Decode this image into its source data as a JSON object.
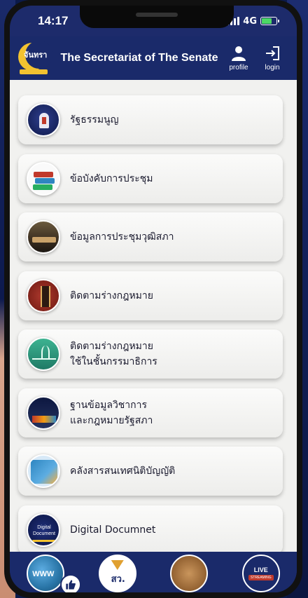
{
  "status_bar": {
    "time": "14:17",
    "network": "4G"
  },
  "header": {
    "logo_text": "จันทรา",
    "title": "The Secretariat of The Senate",
    "profile_label": "profile",
    "login_label": "login"
  },
  "menu": {
    "items": [
      {
        "icon": "constitution-icon",
        "label_line1": "รัฐธรรมนูญ",
        "label_line2": ""
      },
      {
        "icon": "books-icon",
        "label_line1": "ข้อบังคับการประชุม",
        "label_line2": ""
      },
      {
        "icon": "meeting-chamber-icon",
        "label_line1": "ข้อมูลการประชุมวุฒิสภา",
        "label_line2": ""
      },
      {
        "icon": "law-tracking-icon",
        "label_line1": "ติดตามร่างกฎหมาย",
        "label_line2": ""
      },
      {
        "icon": "committee-tracking-icon",
        "label_line1": "ติดตามร่างกฎหมาย",
        "label_line2": "ใช้ในชั้นกรรมาธิการ"
      },
      {
        "icon": "academic-database-icon",
        "label_line1": "ฐานข้อมูลวิชาการ",
        "label_line2": "และกฎหมายรัฐสภา"
      },
      {
        "icon": "legislative-archive-icon",
        "label_line1": "คลังสารสนเทศนิติบัญญัติ",
        "label_line2": ""
      },
      {
        "icon": "digital-document-icon",
        "label_line1": "Digital Documnet",
        "label_line2": ""
      }
    ],
    "digital_icon_text": "Digital Document"
  },
  "bottom_bar": {
    "www_text": "WWW",
    "senate_text": "สว.",
    "live_text": "LIVE",
    "streaming_text": "STREAMING"
  },
  "colors": {
    "header_bg": "#1a2a6a",
    "content_bg": "#f1f1ef",
    "accent_gold": "#f2c230"
  }
}
